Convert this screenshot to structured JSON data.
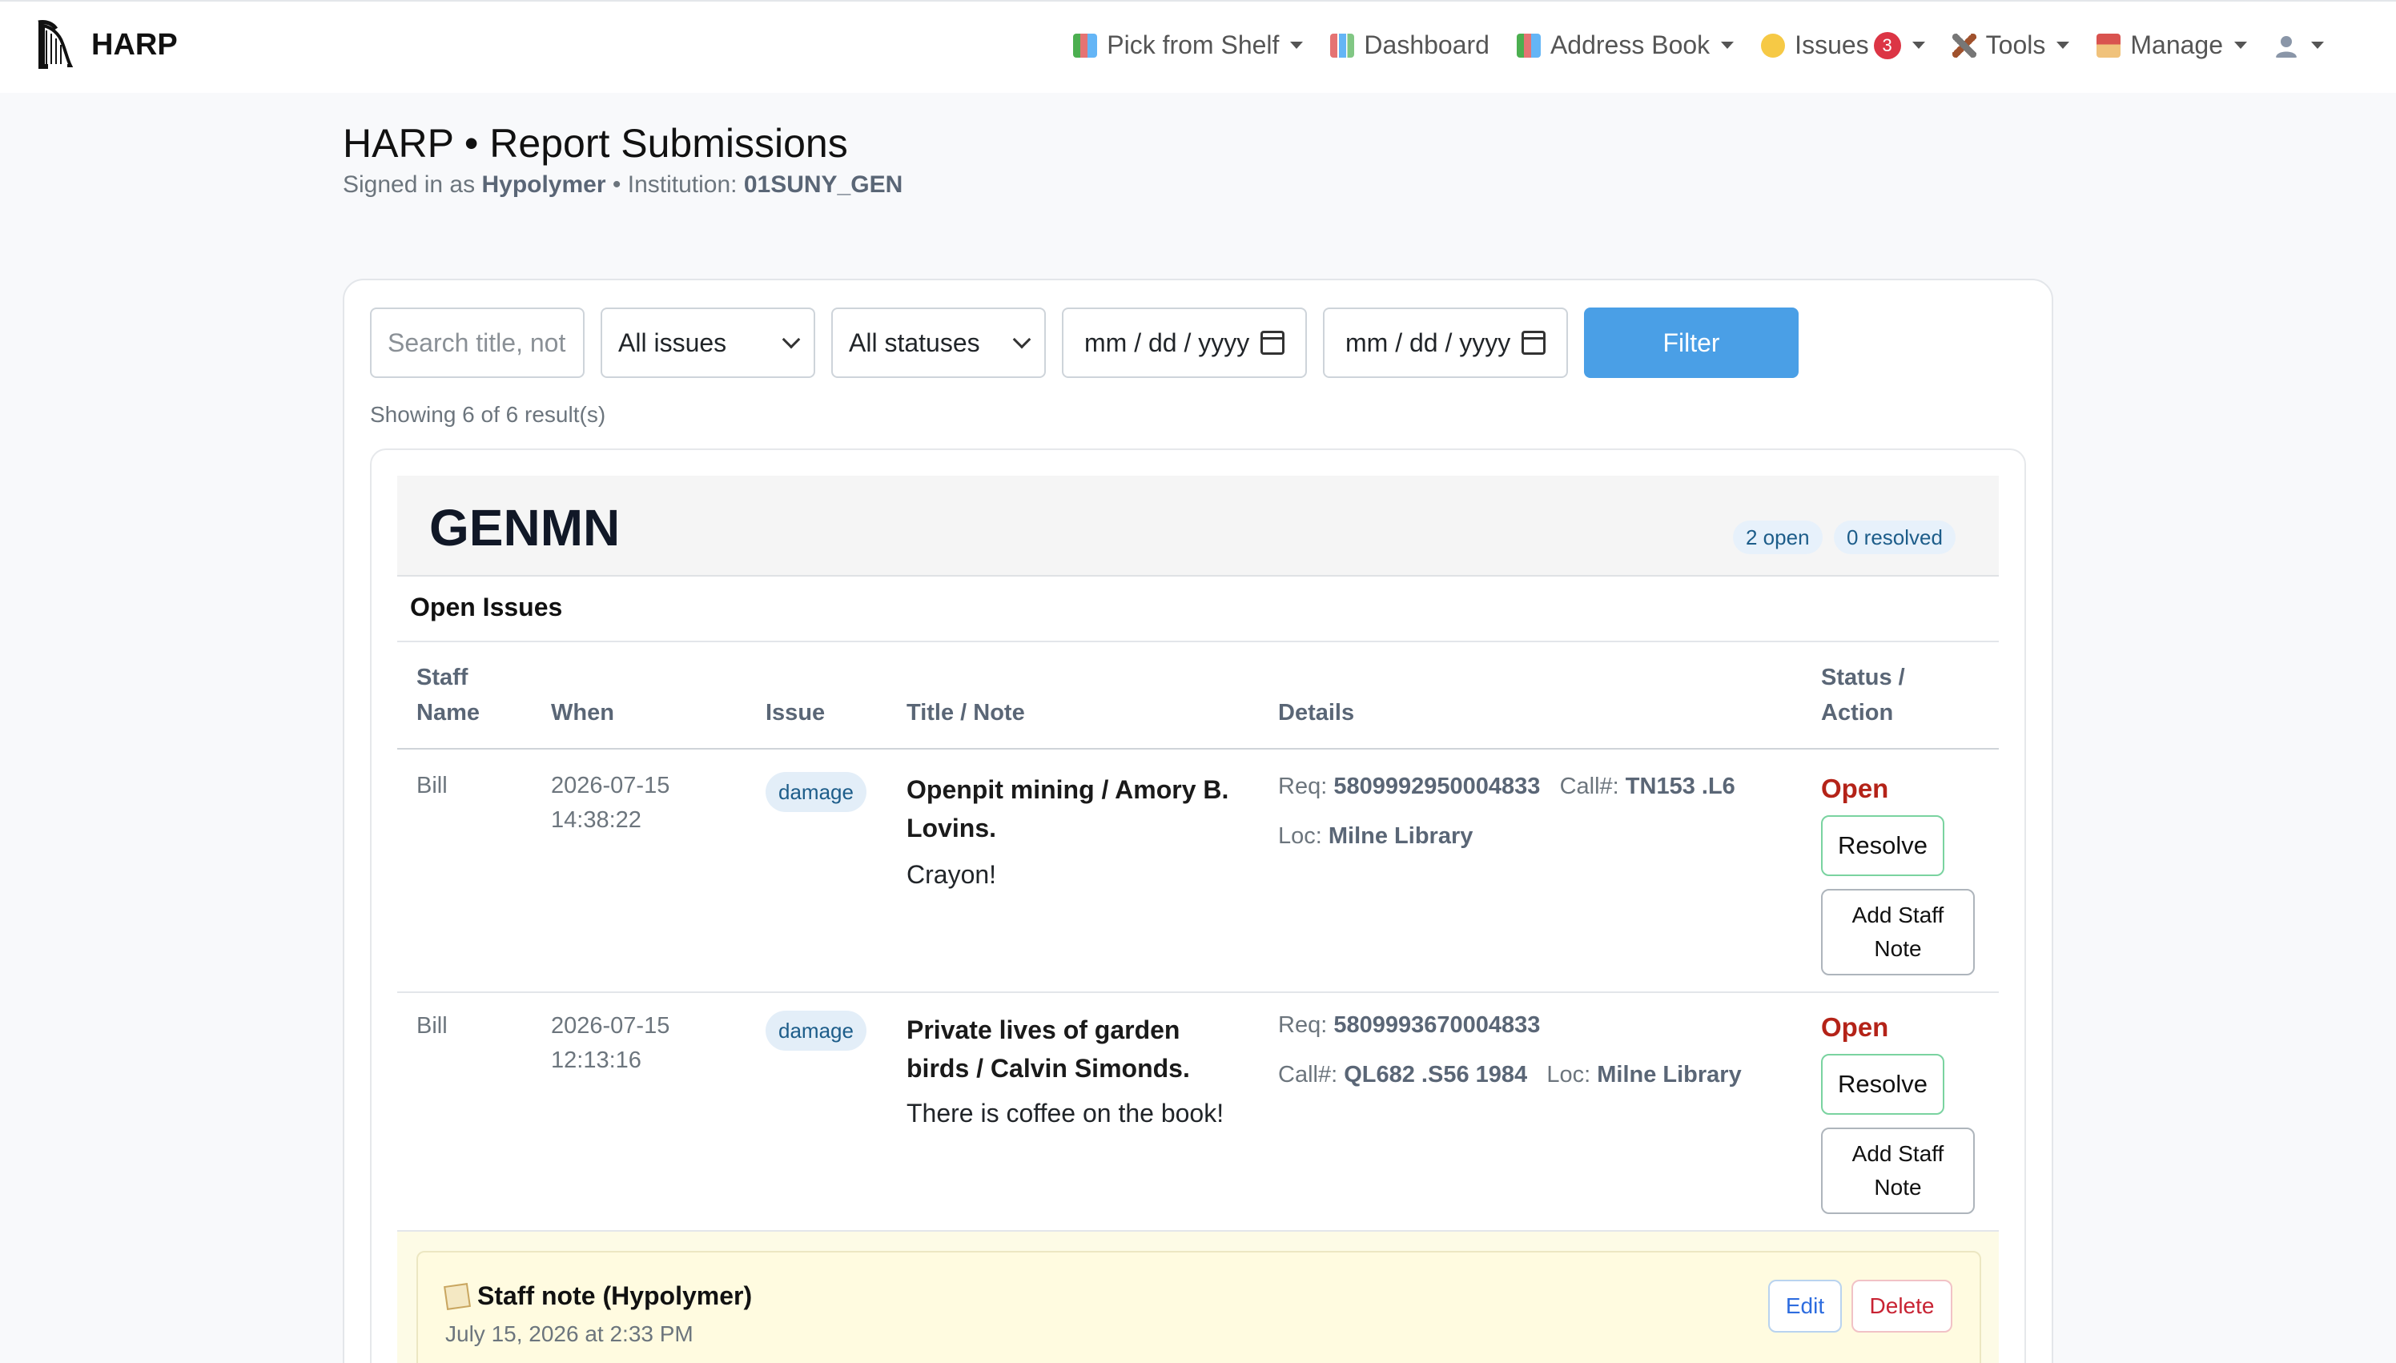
{
  "nav": {
    "brand": "HARP",
    "items": [
      {
        "label": "Pick from Shelf",
        "icon": "books-icon",
        "dropdown": true
      },
      {
        "label": "Dashboard",
        "icon": "chart-icon",
        "dropdown": false
      },
      {
        "label": "Address Book",
        "icon": "books-icon",
        "dropdown": true
      },
      {
        "label": "Issues",
        "icon": "face-icon",
        "dropdown": true,
        "badge": "3"
      },
      {
        "label": "Tools",
        "icon": "tools-icon",
        "dropdown": true
      },
      {
        "label": "Manage",
        "icon": "house-icon",
        "dropdown": true
      }
    ]
  },
  "header": {
    "title": "HARP • Report Submissions",
    "signed_prefix": "Signed in as",
    "user": "Hypolymer",
    "sep": "•",
    "institution_label": "Institution:",
    "institution": "01SUNY_GEN"
  },
  "filters": {
    "search_placeholder": "Search title, not",
    "issue_select": "All issues",
    "status_select": "All statuses",
    "date_from": "mm / dd / yyyy",
    "date_to": "mm / dd / yyyy",
    "filter_button": "Filter"
  },
  "showing": "Showing 6 of 6 result(s)",
  "group": {
    "title": "GENMN",
    "open_count": "2 open",
    "resolved_count": "0 resolved",
    "section": "Open Issues",
    "columns": {
      "staff_1": "Staff",
      "staff_2": "Name",
      "when": "When",
      "issue": "Issue",
      "title": "Title / Note",
      "details": "Details",
      "status_1": "Status /",
      "status_2": "Action"
    },
    "rows": [
      {
        "staff": "Bill",
        "date": "2026-07-15",
        "time": "14:38:22",
        "issue": "damage",
        "title_1": "Openpit mining / Amory B.",
        "title_2": "Lovins.",
        "note": "Crayon!",
        "req_label": "Req:",
        "req": "5809992950004833",
        "call_label": "Call#:",
        "call": "TN153 .L6",
        "loc_label": "Loc:",
        "loc": "Milne Library",
        "status": "Open",
        "resolve": "Resolve",
        "add_note_1": "Add Staff",
        "add_note_2": "Note"
      },
      {
        "staff": "Bill",
        "date": "2026-07-15",
        "time": "12:13:16",
        "issue": "damage",
        "title_1": "Private lives of garden",
        "title_2": "birds / Calvin Simonds.",
        "note": "There is coffee on the book!",
        "req_label": "Req:",
        "req": "5809993670004833",
        "call_label": "Call#:",
        "call": "QL682 .S56 1984",
        "loc_label": "Loc:",
        "loc": "Milne Library",
        "status": "Open",
        "resolve": "Resolve",
        "add_note_1": "Add Staff",
        "add_note_2": "Note"
      }
    ],
    "staff_note": {
      "title": "Staff note (Hypolymer)",
      "date": "July 15, 2026 at 2:33 PM",
      "edit": "Edit",
      "delete": "Delete"
    }
  }
}
